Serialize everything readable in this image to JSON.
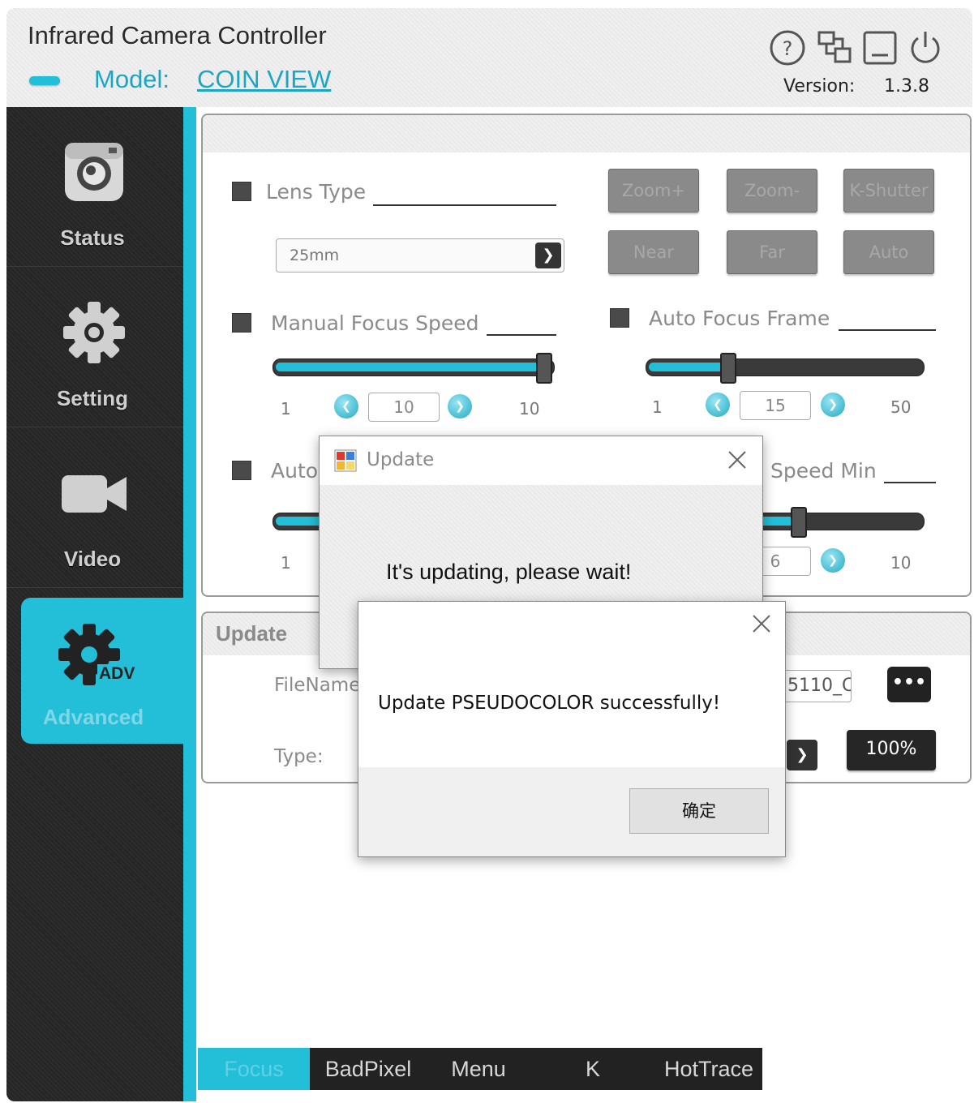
{
  "header": {
    "title": "Infrared Camera Controller",
    "model_label": "Model:",
    "model_value": "COIN VIEW",
    "version_label": "Version:",
    "version_value": "1.3.8",
    "icons": [
      "help-icon",
      "network-icon",
      "minimize-icon",
      "power-icon"
    ]
  },
  "sidebar": {
    "items": [
      {
        "label": "Status",
        "icon": "camera-icon"
      },
      {
        "label": "Setting",
        "icon": "gear-icon"
      },
      {
        "label": "Video",
        "icon": "video-camera-icon"
      },
      {
        "label": "Advanced",
        "icon": "adv-gear-icon",
        "badge": "ADV",
        "active": true
      }
    ]
  },
  "focus_panel": {
    "lens_type_label": "Lens Type",
    "lens_type_value": "25mm",
    "buttons": {
      "zoom_plus": "Zoom+",
      "zoom_minus": "Zoom-",
      "shutter": "K-Shutter",
      "near": "Near",
      "far": "Far",
      "auto": "Auto"
    },
    "manual_focus_speed": {
      "label": "Manual Focus Speed",
      "min": "1",
      "value": "10",
      "max": "10",
      "level": 1.0
    },
    "auto_focus_frame": {
      "label": "Auto Focus Frame",
      "min": "1",
      "value": "15",
      "max": "50",
      "level": 0.29
    },
    "auto_speed_left": {
      "label_partial": "Auto",
      "min": "1",
      "level": 0.2
    },
    "auto_speed_min": {
      "label_partial": "Speed Min",
      "value_partial": "6",
      "max": "10",
      "level": 0.56
    }
  },
  "update_panel": {
    "title": "Update",
    "filename_label": "FileName",
    "filename_value_partial": "5110_C",
    "browse_label": "•••",
    "type_label": "Type:",
    "progress_label": "100%"
  },
  "tabs": [
    {
      "label": "Focus",
      "active": true
    },
    {
      "label": "BadPixel"
    },
    {
      "label": "Menu"
    },
    {
      "label": "K"
    },
    {
      "label": "HotTrace"
    }
  ],
  "dialog_updating": {
    "title": "Update",
    "message": "It's updating, please wait!"
  },
  "dialog_success": {
    "message": "Update PSEUDOCOLOR successfully!",
    "ok_label": "确定"
  },
  "colors": {
    "accent": "#23bfd8",
    "sidebar": "#262626",
    "header_bg": "#efefef"
  }
}
